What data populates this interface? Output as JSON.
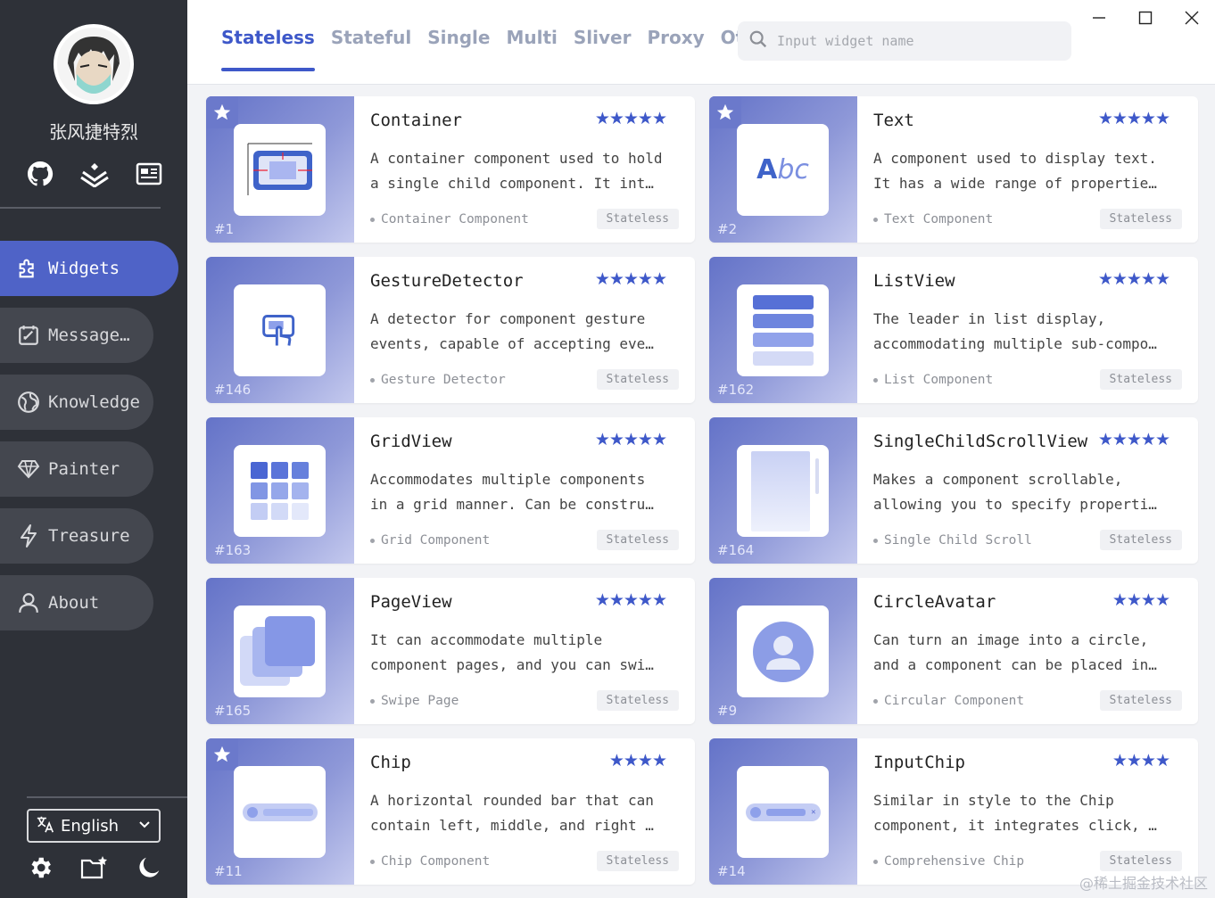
{
  "sidebar": {
    "username": "张风捷特烈",
    "nav": [
      {
        "label": "Widgets",
        "active": true
      },
      {
        "label": "Message…",
        "active": false
      },
      {
        "label": "Knowledge",
        "active": false
      },
      {
        "label": "Painter",
        "active": false
      },
      {
        "label": "Treasure",
        "active": false
      },
      {
        "label": "About",
        "active": false
      }
    ],
    "language": "English"
  },
  "header": {
    "tabs": [
      "Stateless",
      "Stateful",
      "Single",
      "Multi",
      "Sliver",
      "Proxy",
      "Other"
    ],
    "active_tab": "Stateless",
    "search_placeholder": "Input widget name"
  },
  "cards": [
    {
      "id": "#1",
      "title": "Container",
      "stars": 5,
      "desc1": "A container component used to hold",
      "desc2": "a single child component. It int…",
      "tag": "Container Component",
      "badge": "Stateless",
      "fav": true,
      "thumb": "container"
    },
    {
      "id": "#2",
      "title": "Text",
      "stars": 5,
      "desc1": "A component used to display text.",
      "desc2": "It has a wide range of propertie…",
      "tag": "Text Component",
      "badge": "Stateless",
      "fav": true,
      "thumb": "text"
    },
    {
      "id": "#146",
      "title": "GestureDetector",
      "stars": 5,
      "desc1": "A detector for component gesture",
      "desc2": "events, capable of accepting eve…",
      "tag": "Gesture Detector",
      "badge": "Stateless",
      "fav": false,
      "thumb": "gesture"
    },
    {
      "id": "#162",
      "title": "ListView",
      "stars": 5,
      "desc1": "The leader in list display,",
      "desc2": "accommodating multiple sub-compo…",
      "tag": "List Component",
      "badge": "Stateless",
      "fav": false,
      "thumb": "list"
    },
    {
      "id": "#163",
      "title": "GridView",
      "stars": 5,
      "desc1": "Accommodates multiple components",
      "desc2": "in a grid manner. Can be constru…",
      "tag": "Grid Component",
      "badge": "Stateless",
      "fav": false,
      "thumb": "grid"
    },
    {
      "id": "#164",
      "title": "SingleChildScrollView",
      "stars": 5,
      "desc1": "Makes a component scrollable,",
      "desc2": "allowing you to specify properti…",
      "tag": "Single Child Scroll",
      "badge": "Stateless",
      "fav": false,
      "thumb": "scroll"
    },
    {
      "id": "#165",
      "title": "PageView",
      "stars": 5,
      "desc1": "It can accommodate multiple",
      "desc2": "component pages, and you can swi…",
      "tag": "Swipe Page",
      "badge": "Stateless",
      "fav": false,
      "thumb": "page"
    },
    {
      "id": "#9",
      "title": "CircleAvatar",
      "stars": 4,
      "desc1": "Can turn an image into a circle,",
      "desc2": "and a component can be placed in…",
      "tag": "Circular Component",
      "badge": "Stateless",
      "fav": false,
      "thumb": "avatar"
    },
    {
      "id": "#11",
      "title": "Chip",
      "stars": 4,
      "desc1": "A horizontal rounded bar that can",
      "desc2": "contain left, middle, and right …",
      "tag": "Chip Component",
      "badge": "Stateless",
      "fav": true,
      "thumb": "chip"
    },
    {
      "id": "#14",
      "title": "InputChip",
      "stars": 4,
      "desc1": "Similar in style to the Chip",
      "desc2": "component, it integrates click, …",
      "tag": "Comprehensive Chip",
      "badge": "Stateless",
      "fav": false,
      "thumb": "inputchip"
    }
  ],
  "watermark": "@稀土掘金技术社区",
  "colors": {
    "accent": "#3e58c9",
    "sidebar": "#2e3138",
    "nav_active": "#4f63c7"
  }
}
